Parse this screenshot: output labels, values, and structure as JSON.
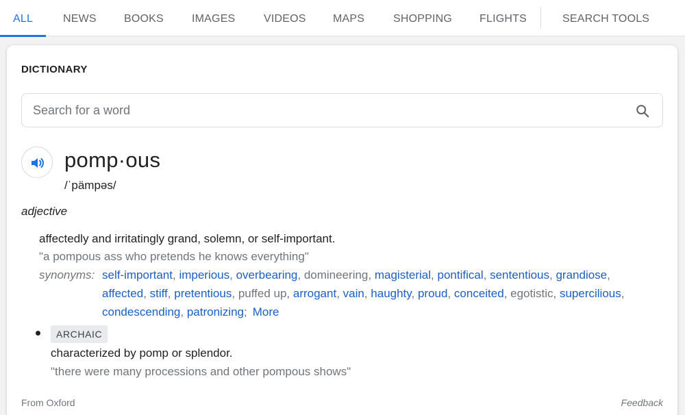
{
  "tabs": [
    {
      "label": "ALL",
      "active": true
    },
    {
      "label": "NEWS",
      "active": false
    },
    {
      "label": "BOOKS",
      "active": false
    },
    {
      "label": "IMAGES",
      "active": false
    },
    {
      "label": "VIDEOS",
      "active": false
    },
    {
      "label": "MAPS",
      "active": false
    },
    {
      "label": "SHOPPING",
      "active": false
    },
    {
      "label": "FLIGHTS",
      "active": false
    },
    {
      "label": "SEARCH TOOLS",
      "active": false
    }
  ],
  "dictionary": {
    "title": "DICTIONARY",
    "search": {
      "placeholder": "Search for a word",
      "value": "",
      "icon": "search-icon"
    },
    "speaker_icon": "speaker-icon",
    "word": "pomp·ous",
    "phonetic": "/ˈpämpəs/",
    "part_of_speech": "adjective",
    "sense1": {
      "definition": "affectedly and irritatingly grand, solemn, or self-important.",
      "example": "\"a pompous ass who pretends he knows everything\"",
      "synonyms_label": "synonyms:",
      "synonyms": [
        {
          "text": "self-important",
          "link": true
        },
        {
          "text": "imperious",
          "link": true
        },
        {
          "text": "overbearing",
          "link": true
        },
        {
          "text": "domineering",
          "link": false
        },
        {
          "text": "magisterial",
          "link": true
        },
        {
          "text": "pontifical",
          "link": true
        },
        {
          "text": "sententious",
          "link": true
        },
        {
          "text": "grandiose",
          "link": true
        },
        {
          "text": "affected",
          "link": true
        },
        {
          "text": "stiff",
          "link": true
        },
        {
          "text": "pretentious",
          "link": true
        },
        {
          "text": "puffed up",
          "link": false
        },
        {
          "text": "arrogant",
          "link": true
        },
        {
          "text": "vain",
          "link": true
        },
        {
          "text": "haughty",
          "link": true
        },
        {
          "text": "proud",
          "link": true
        },
        {
          "text": "conceited",
          "link": true
        },
        {
          "text": "egotistic",
          "link": false
        },
        {
          "text": "supercilious",
          "link": true
        },
        {
          "text": "condescending",
          "link": true
        },
        {
          "text": "patronizing",
          "link": true
        }
      ],
      "more_label": "More"
    },
    "sense2": {
      "badge": "ARCHAIC",
      "definition": "characterized by pomp or splendor.",
      "example": "\"there were many processions and other pompous shows\""
    },
    "source": "From Oxford",
    "feedback": "Feedback"
  },
  "colors": {
    "accent": "#1a73e8",
    "link": "#1a5fc4",
    "muted": "#70757a"
  }
}
